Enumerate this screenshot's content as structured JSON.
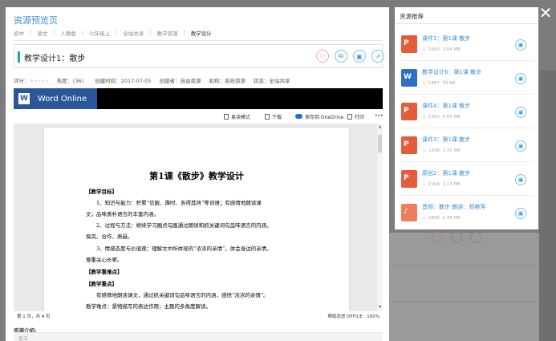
{
  "modal": {
    "title": "资源预览页",
    "breadcrumb": [
      "初中",
      "语文",
      "人教版",
      "七年级上",
      "全站共享",
      "教学资源",
      "教学设计"
    ],
    "doc_title": "教学设计1：散步",
    "meta": {
      "rating_label": "评分：",
      "heat": "热度：（36）",
      "created": "创建时间：2017-07-05",
      "creator": "创建者：自由资源",
      "org": "机构：系统资源",
      "status": "状态：全站共享"
    },
    "word_online": "Word Online",
    "toolbar": {
      "read_mode": "易读模式",
      "download": "下载",
      "save_onedrive": "保存到 OneDrive",
      "print": "打印",
      "more": "•••"
    },
    "document": {
      "heading": "第1课《散步》教学设计",
      "lines": [
        "【教学目标】",
        "　　1、知识与能力：积累“信服、霹时、各得其所”等词语；有感情地朗读课",
        "文；品味质朴语言的丰富内涵。",
        "　　2、过程与方法：继续学习圈点勾画通过朗读和抓关键词句品味语言的内涵，",
        "探究、合作、质疑。",
        "　　3、情感态度与价值观：理解文中所体现的“浓浓的亲情”。体会身边的亲情，",
        "尊重关心长辈。",
        "【教学重难点】",
        "【教学重点】",
        "　　有感情地朗读课文，通过抓关键词句品味语言的内涵，感悟“浓浓的亲情”。",
        "教学难点：景物描写的表达作用；主题的多角度解读。"
      ]
    },
    "status_left": "第 1 页，共 4 页",
    "status_right": "帮助改进 OFFICE　100%",
    "description_label": "资源介绍:",
    "description_placeholder": "暂无"
  },
  "recommend": {
    "title": "资源推荐",
    "items": [
      {
        "name": "课件1：第1课 散步",
        "heat": "1990",
        "size": "1.04 MB",
        "type": "ppt"
      },
      {
        "name": "教学设计6：第1课 散步",
        "heat": "1987",
        "size": "53 KB",
        "type": "word"
      },
      {
        "name": "课件4：第1课 散步",
        "heat": "1950",
        "size": "4.01 MB",
        "type": "ppt"
      },
      {
        "name": "课件3：第1课 散步",
        "heat": "1938",
        "size": "1.31 MB",
        "type": "ppt"
      },
      {
        "name": "原创2：第1课 散步",
        "heat": "1904",
        "size": "1.13 MB",
        "type": "ppt"
      },
      {
        "name": "音频：散步 朗读：郑艳萍",
        "heat": "1895",
        "size": "2.48 MB",
        "type": "audio"
      }
    ]
  },
  "close_label": "✕",
  "colors": {
    "accent": "#3a8fd6",
    "teal": "#1fa5a7",
    "word_blue": "#2b579a",
    "ppt_orange": "#e45c3a"
  }
}
